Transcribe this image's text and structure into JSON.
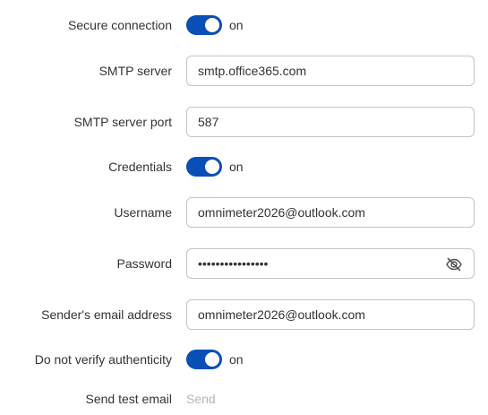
{
  "settings": {
    "secure_connection": {
      "label": "Secure connection",
      "state": "on"
    },
    "smtp_server": {
      "label": "SMTP server",
      "value": "smtp.office365.com"
    },
    "smtp_port": {
      "label": "SMTP server port",
      "value": "587"
    },
    "credentials": {
      "label": "Credentials",
      "state": "on"
    },
    "username": {
      "label": "Username",
      "value": "omnimeter2026@outlook.com"
    },
    "password": {
      "label": "Password",
      "masked": "••••••••••••••••"
    },
    "sender_email": {
      "label": "Sender's email address",
      "value": "omnimeter2026@outlook.com"
    },
    "no_verify": {
      "label": "Do not verify authenticity",
      "state": "on"
    },
    "send_test": {
      "label": "Send test email",
      "link": "Send"
    }
  },
  "colors": {
    "toggle_on": "#0a4fb5",
    "field_border": "#c4c4c4",
    "link_disabled": "#b5b5b5"
  },
  "icons": {
    "password_toggle": "eye-slash-icon"
  }
}
